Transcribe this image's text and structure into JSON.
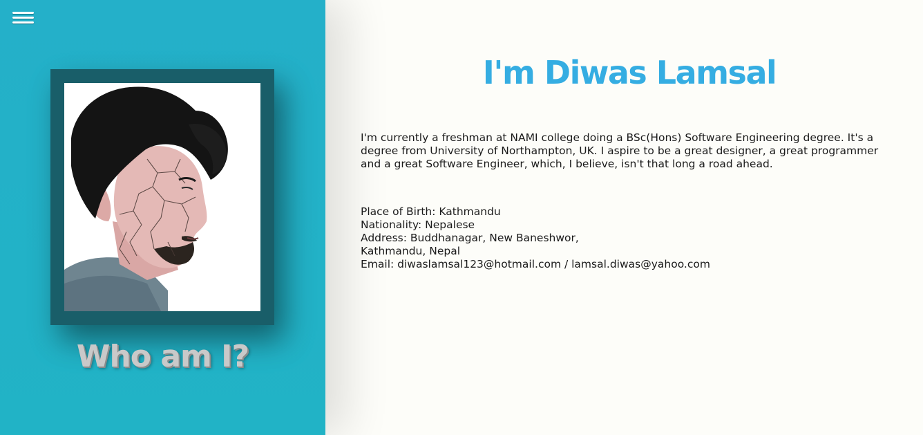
{
  "sidebar": {
    "menu_icon": "hamburger-menu-icon",
    "background_color": "#22b2c8",
    "frame_color": "#195e69",
    "heading": "Who am I?"
  },
  "main": {
    "title": "I'm Diwas Lamsal",
    "bio": "I'm currently a freshman at NAMI college doing a BSc(Hons) Software Engineering degree. It's a degree from University of Northampton, UK. I aspire to be a great designer, a great programmer and a great Software Engineer, which, I believe, isn't that long a road ahead.",
    "details": {
      "place_of_birth": "Place of Birth: Kathmandu",
      "nationality": "Nationality: Nepalese",
      "address_line1": "Address: Buddhanagar, New Baneshwor,",
      "address_line2": "Kathmandu, Nepal",
      "email": "Email: diwaslamsal123@hotmail.com / lamsal.diwas@yahoo.com"
    },
    "title_color": "#35ade2"
  }
}
